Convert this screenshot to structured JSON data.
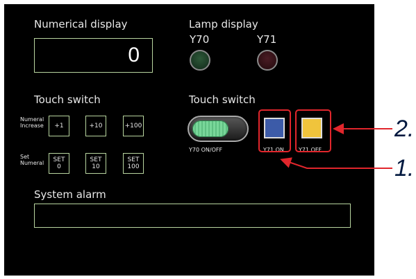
{
  "numerical_display": {
    "title": "Numerical display",
    "value": "0"
  },
  "lamp_display": {
    "title": "Lamp display",
    "lamps": [
      {
        "label": "Y70",
        "color": "#1e4128"
      },
      {
        "label": "Y71",
        "color": "#3a141a"
      }
    ]
  },
  "touch_switch_left": {
    "title": "Touch switch",
    "rows": [
      {
        "label": "Numeral\nIncrease",
        "buttons": [
          "+1",
          "+10",
          "+100"
        ]
      },
      {
        "label": "Set\nNumeral",
        "buttons": [
          "SET\n0",
          "SET\n10",
          "SET\n100"
        ]
      }
    ]
  },
  "touch_switch_right": {
    "title": "Touch switch",
    "toggle_label": "Y70 ON/OFF",
    "buttons": [
      {
        "label": "Y71 ON",
        "color": "#3c5ba8"
      },
      {
        "label": "Y71 OFF",
        "color": "#f0c43c"
      }
    ]
  },
  "system_alarm": {
    "title": "System alarm"
  },
  "callouts": {
    "color": "#e1262c",
    "label_1": "1.",
    "label_2": "2."
  }
}
